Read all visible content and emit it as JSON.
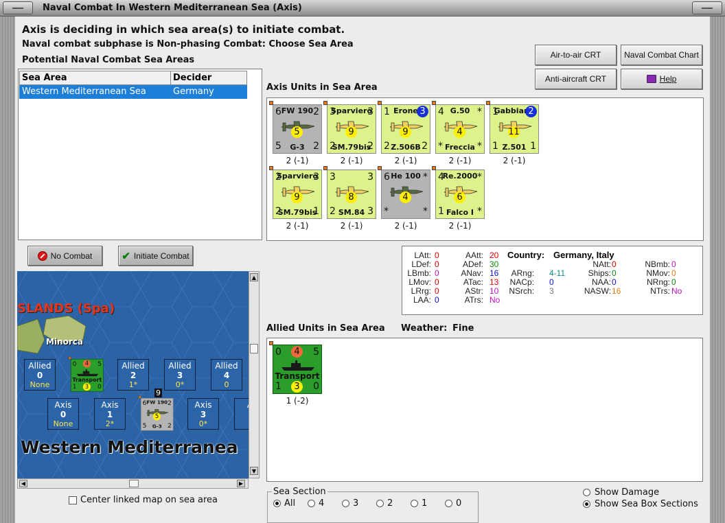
{
  "window": {
    "title": "Naval Combat In Western Mediterranean Sea (Axis)"
  },
  "header": {
    "line1": "Axis is deciding in which sea area(s) to initiate combat.",
    "line2": "Naval combat subphase is Non-phasing Combat: Choose Sea Area",
    "line3": "Potential Naval Combat Sea Areas"
  },
  "buttons": {
    "air_to_air": "Air-to-air CRT",
    "naval_chart": "Naval Combat Chart",
    "anti_aircraft": "Anti-aircraft CRT",
    "help": "Help",
    "no_combat": "No Combat",
    "initiate_combat": "Initiate Combat"
  },
  "table": {
    "headers": [
      "Sea Area",
      "Decider"
    ],
    "rows": [
      {
        "area": "Western Mediterranean Sea",
        "decider": "Germany"
      }
    ]
  },
  "axis_section": {
    "title": "Axis Units in Sea Area"
  },
  "allied_section": {
    "title": "Allied Units in Sea Area",
    "weather_label": "Weather:",
    "weather_value": "Fine"
  },
  "colors": {
    "selection": "#1e7fd8",
    "counter_green": "#dcf28a",
    "counter_gray": "#b4b4b4",
    "transport_green": "#2a9d2a",
    "sea_blue": "#2b63a5"
  },
  "axis_units": [
    {
      "name": "FW 190",
      "sub": "G-3",
      "tl": "6",
      "tr": "2",
      "bl": "5",
      "br": "2",
      "circle": "5",
      "caption": "2 (-1)",
      "color": "gray"
    },
    {
      "name": "Sparviero",
      "sub": "SM.79bis",
      "tl": "3",
      "tr": "3",
      "bl": "2",
      "br": "2",
      "circle": "9",
      "caption": "2 (-1)",
      "color": "green"
    },
    {
      "name": "Erone",
      "sub": "Z.506B",
      "tl": "1",
      "tr": "",
      "bl": "2",
      "br": "2",
      "circle": "9",
      "circle_top": "3",
      "caption": "2 (-1)",
      "color": "green"
    },
    {
      "name": "G.50",
      "sub": "Freccia",
      "tl": "4",
      "tr": "*",
      "bl": "*",
      "br": "*",
      "circle": "4",
      "caption": "2 (-1)",
      "color": "green"
    },
    {
      "name": "Gabbiano",
      "sub": "Z.501",
      "tl": "1",
      "tr": "",
      "bl": "1",
      "br": "1",
      "circle": "11",
      "circle_top": "2",
      "caption": "2 (-1)",
      "color": "green"
    },
    {
      "name": "Sparviero",
      "sub": "SM.79bis",
      "tl": "2",
      "tr": "3",
      "bl": "2",
      "br": "1",
      "circle": "9",
      "caption": "2 (-1)",
      "color": "green"
    },
    {
      "name": "",
      "sub": "SM.84",
      "tl": "3",
      "tr": "3",
      "bl": "2",
      "br": "3",
      "circle": "8",
      "caption": "2 (-1)",
      "color": "green"
    },
    {
      "name": "He 100",
      "sub": "",
      "tl": "6",
      "tr": "*",
      "bl": "*",
      "br": "*",
      "circle": "4",
      "caption": "2 (-1)",
      "color": "gray"
    },
    {
      "name": "Re.2000",
      "sub": "Falco I",
      "tl": "4",
      "tr": "*",
      "bl": "1",
      "br": "*",
      "circle": "6",
      "caption": "2 (-1)",
      "color": "green"
    }
  ],
  "allied_units": [
    {
      "name": "Transport",
      "tl": "0",
      "tr": "5",
      "bl": "1",
      "br": "0",
      "circle_top": "4",
      "circle": "3",
      "caption": "1 (-2)"
    }
  ],
  "stats": {
    "country_label": "Country:",
    "country_value": "Germany, Italy",
    "col1": [
      [
        "LAtt:",
        "0"
      ],
      [
        "LDef:",
        "0"
      ],
      [
        "LBmb:",
        "0"
      ],
      [
        "LMov:",
        "0"
      ],
      [
        "LRrg:",
        "0"
      ],
      [
        "LAA:",
        "0"
      ]
    ],
    "col2": [
      [
        "AAtt:",
        "20"
      ],
      [
        "ADef:",
        "30"
      ],
      [
        "ANav:",
        "16"
      ],
      [
        "ATac:",
        "13"
      ],
      [
        "AStr:",
        "10"
      ],
      [
        "ATrs:",
        "No"
      ]
    ],
    "col3": [
      [
        "ARng:",
        "4-11"
      ],
      [
        "NACp:",
        "0"
      ],
      [
        "NSrch:",
        "3"
      ]
    ],
    "col4": [
      [
        "NAtt:",
        "0"
      ],
      [
        "Ships:",
        "0"
      ],
      [
        "NAA:",
        "0"
      ],
      [
        "NASW:",
        "16"
      ]
    ],
    "col5": [
      [
        "NBmb:",
        "0"
      ],
      [
        "NMov:",
        "0"
      ],
      [
        "NRng:",
        "0"
      ],
      [
        "NTrs:",
        "No"
      ]
    ]
  },
  "map": {
    "region_label": "SLANDS (Spa)",
    "island_label": "Minorca",
    "sea_label": "Western Mediterranea",
    "allied_boxes": [
      {
        "label": "Allied",
        "num": "0",
        "sub": "None"
      },
      {
        "label": "Allied",
        "num": "2",
        "sub": "1*"
      },
      {
        "label": "Allied",
        "num": "3",
        "sub": "0*"
      },
      {
        "label": "Allied",
        "num": "4",
        "sub": "0"
      }
    ],
    "axis_boxes": [
      {
        "label": "Axis",
        "num": "0",
        "sub": "None"
      },
      {
        "label": "Axis",
        "num": "1",
        "sub": "2*"
      },
      {
        "label": "Axis",
        "num": "3",
        "sub": "0*"
      },
      {
        "label": "A",
        "num": "",
        "sub": ""
      }
    ],
    "stack_count": "9",
    "map_transport": {
      "tl": "0",
      "tr": "5",
      "bl": "1",
      "br": "0",
      "circle_top": "4",
      "circle": "3",
      "name": "Transport"
    },
    "map_fw": {
      "name": "FW 190",
      "sub": "G-3",
      "tl": "6",
      "tr": "2",
      "bl": "5",
      "br": "2",
      "circle": "5"
    }
  },
  "bottom": {
    "center_map_label": "Center linked map on sea area",
    "sea_section_label": "Sea Section",
    "sections": [
      "All",
      "4",
      "3",
      "2",
      "1",
      "0"
    ],
    "show_damage": "Show Damage",
    "show_boxes": "Show Sea Box Sections"
  }
}
